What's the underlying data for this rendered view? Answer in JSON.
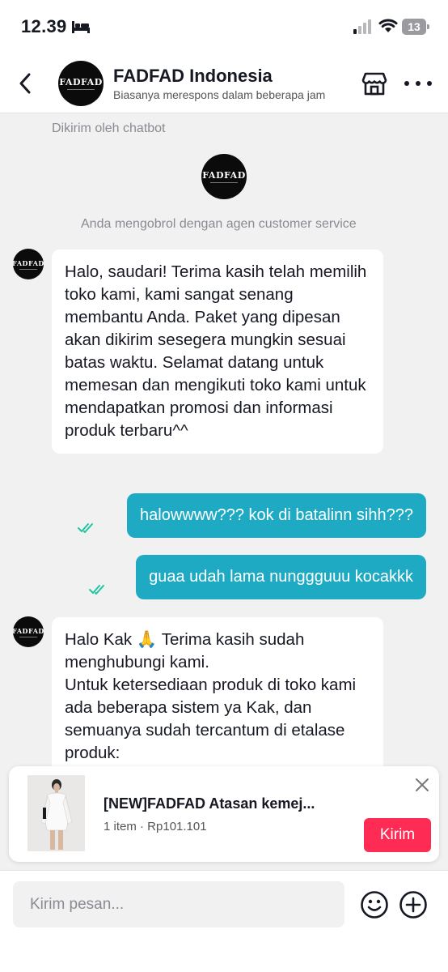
{
  "status_bar": {
    "time": "12.39",
    "battery": "13",
    "icons": [
      "bed-icon",
      "signal-icon",
      "wifi-icon",
      "battery-icon"
    ]
  },
  "header": {
    "title": "FADFAD Indonesia",
    "subtitle": "Biasanya merespons dalam beberapa jam",
    "avatar_logo": "FADFAD",
    "icons": [
      "back-arrow-icon",
      "store-icon",
      "more-icon"
    ]
  },
  "chat": {
    "sent_by_label": "Dikirim oleh chatbot",
    "agent_notice": "Anda mengobrol dengan agen customer service",
    "messages": [
      {
        "from": "shop",
        "text": "Halo, saudari! Terima kasih telah memilih toko kami, kami sangat senang membantu Anda. Paket yang dipesan akan dikirim sesegera mungkin sesuai batas waktu. Selamat datang untuk memesan dan mengikuti toko kami untuk mendapatkan promosi dan informasi produk terbaru^^"
      },
      {
        "from": "user",
        "text": "halowwww??? kok di batalinn sihh???"
      },
      {
        "from": "user",
        "text": "guaa udah lama nunggguuu kocakkk"
      },
      {
        "from": "shop",
        "line1": "Halo Kak 🙏 Terima kasih sudah menghubungi kami.",
        "line2": "Untuk ketersediaan produk di toko kami ada beberapa sistem ya Kak, dan semuanya sudah tercantum di etalase produk:"
      }
    ]
  },
  "product_card": {
    "title": "[NEW]FADFAD Atasan kemej...",
    "meta": "1 item · Rp101.101",
    "send_label": "Kirim"
  },
  "composer": {
    "placeholder": "Kirim pesan..."
  },
  "colors": {
    "accent_teal": "#1faac3",
    "send_red": "#fe2c55",
    "check_teal": "#20c4a0",
    "background": "#f1f1f2"
  }
}
